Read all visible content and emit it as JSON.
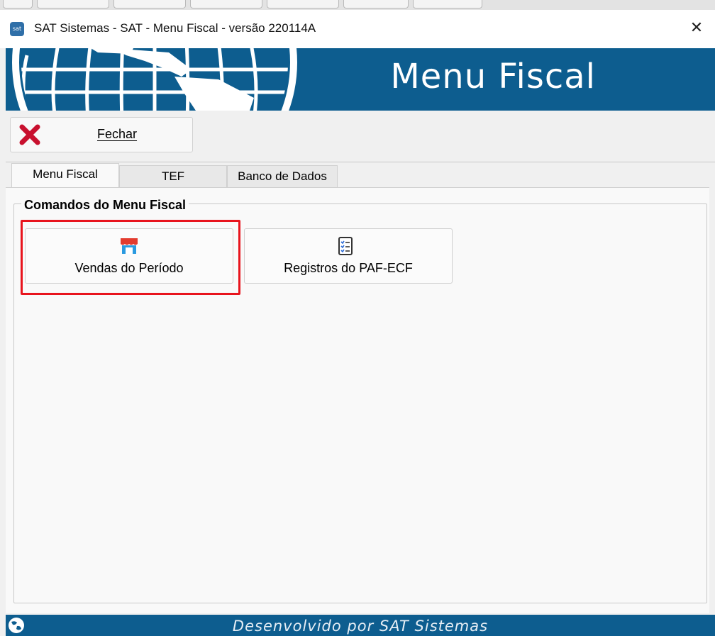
{
  "window": {
    "title": "SAT Sistemas - SAT - Menu Fiscal - versão 220114A",
    "app_icon_text": "sat",
    "close_glyph": "✕"
  },
  "banner": {
    "title": "Menu Fiscal"
  },
  "toolbar": {
    "close_button_label": "Fechar",
    "close_button_icon": "red-x-icon"
  },
  "tabs": [
    {
      "label": "Menu Fiscal",
      "active": true
    },
    {
      "label": "TEF",
      "active": false
    },
    {
      "label": "Banco de Dados",
      "active": false
    }
  ],
  "group": {
    "title": "Comandos do Menu Fiscal",
    "commands": [
      {
        "label": "Vendas do Período",
        "icon": "store-icon",
        "highlighted": true
      },
      {
        "label": "Registros do PAF-ECF",
        "icon": "checklist-icon",
        "highlighted": false
      }
    ]
  },
  "footer": {
    "text": "Desenvolvido por SAT Sistemas"
  },
  "colors": {
    "brand_blue": "#0d5d8f",
    "highlight_red": "#e8141d",
    "close_icon_red": "#c8102e"
  }
}
